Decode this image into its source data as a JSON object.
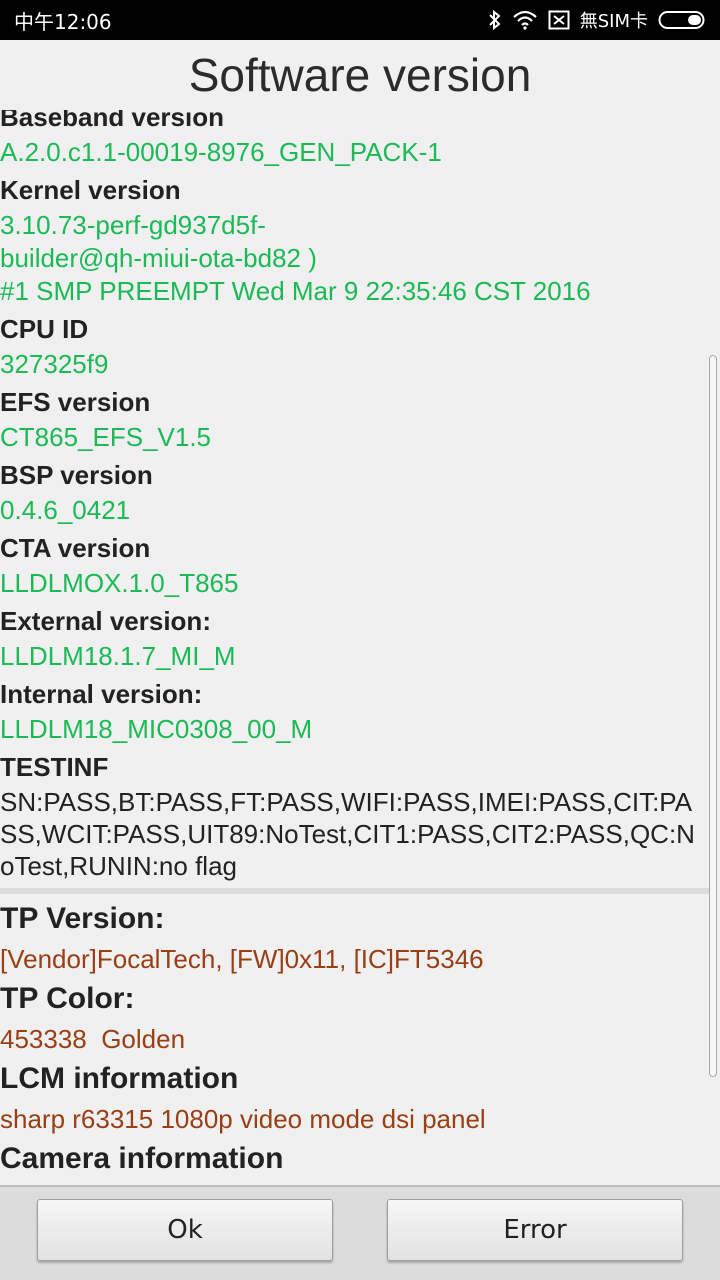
{
  "status_bar": {
    "time": "中午12:06",
    "sim_label": "無SIM卡",
    "icons": [
      "bluetooth-icon",
      "wifi-icon",
      "no-sim-icon",
      "battery-icon"
    ]
  },
  "title": "Software version",
  "items": [
    {
      "label": "Baseband version",
      "value": "A.2.0.c1.1-00019-8976_GEN_PACK-1"
    },
    {
      "label": "Kernel version",
      "value_lines": [
        "3.10.73-perf-gd937d5f-",
        "builder@qh-miui-ota-bd82 )",
        "#1 SMP PREEMPT Wed Mar 9 22:35:46 CST 2016"
      ]
    },
    {
      "label": "CPU ID",
      "value": "327325f9"
    },
    {
      "label": "EFS version",
      "value": "CT865_EFS_V1.5"
    },
    {
      "label": "BSP version",
      "value": "0.4.6_0421"
    },
    {
      "label": "CTA version",
      "value": "LLDLMOX.1.0_T865"
    },
    {
      "label": "External version:",
      "value": "LLDLM18.1.7_MI_M"
    },
    {
      "label": "Internal version:",
      "value": "LLDLM18_MIC0308_00_M"
    },
    {
      "label": "TESTINF",
      "value": "SN:PASS,BT:PASS,FT:PASS,WIFI:PASS,IMEI:PASS,CIT:PASS,WCIT:PASS,UIT89:NoTest,CIT1:PASS,CIT2:PASS,QC:NoTest,RUNIN:no flag"
    }
  ],
  "hardware": [
    {
      "label": "TP Version:",
      "value": "[Vendor]FocalTech, [FW]0x11, [IC]FT5346"
    },
    {
      "label": "TP Color:",
      "value": "453338  Golden"
    },
    {
      "label": "LCM information",
      "value": "sharp r63315 1080p video mode dsi panel"
    },
    {
      "label": "Camera information",
      "value": ""
    }
  ],
  "buttons": {
    "ok": "Ok",
    "error": "Error"
  },
  "colors": {
    "value_green": "#1aba55",
    "value_brown": "#9a3e14"
  }
}
